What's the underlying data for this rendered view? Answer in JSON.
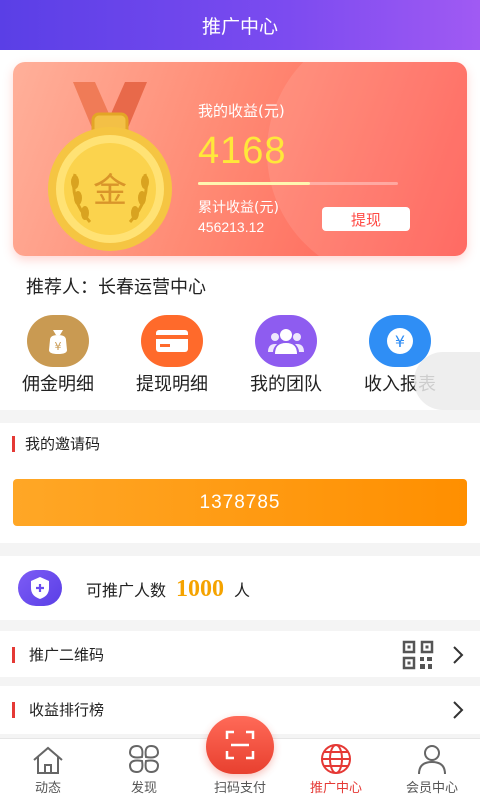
{
  "header": {
    "title": "推广中心"
  },
  "earnings": {
    "label": "我的收益(元)",
    "value": "4168",
    "progress": 0.56,
    "total_label": "累计收益(元)",
    "total_value": "456213.12",
    "withdraw_label": "提现",
    "medal_text": "金"
  },
  "referrer": {
    "label": "推荐人：",
    "name": "长春运营中心"
  },
  "quick_actions": [
    {
      "label": "佣金明细",
      "icon": "money-bag-icon",
      "color": "#c99a52"
    },
    {
      "label": "提现明细",
      "icon": "credit-card-icon",
      "color": "#ff6a2b"
    },
    {
      "label": "我的团队",
      "icon": "team-icon",
      "color": "#8e5cf0"
    },
    {
      "label": "收入报表",
      "icon": "yen-coin-icon",
      "color": "#2f8ef5"
    }
  ],
  "invite": {
    "title": "我的邀请码",
    "code": "1378785"
  },
  "promote_count": {
    "prefix": "可推广人数",
    "value": "1000",
    "suffix": "人"
  },
  "rows": [
    {
      "title": "推广二维码"
    },
    {
      "title": "收益排行榜"
    }
  ],
  "tabbar": [
    {
      "label": "动态",
      "icon": "home-icon"
    },
    {
      "label": "发现",
      "icon": "discover-icon"
    },
    {
      "label": "扫码支付",
      "icon": "scan-icon"
    },
    {
      "label": "推广中心",
      "icon": "globe-icon",
      "active": true
    },
    {
      "label": "会员中心",
      "icon": "user-icon"
    }
  ],
  "colors": {
    "accent": "#e53935",
    "brand_purple": "#5a3fe6",
    "invite_orange": "#ff9800",
    "count_gold": "#f5a300"
  }
}
